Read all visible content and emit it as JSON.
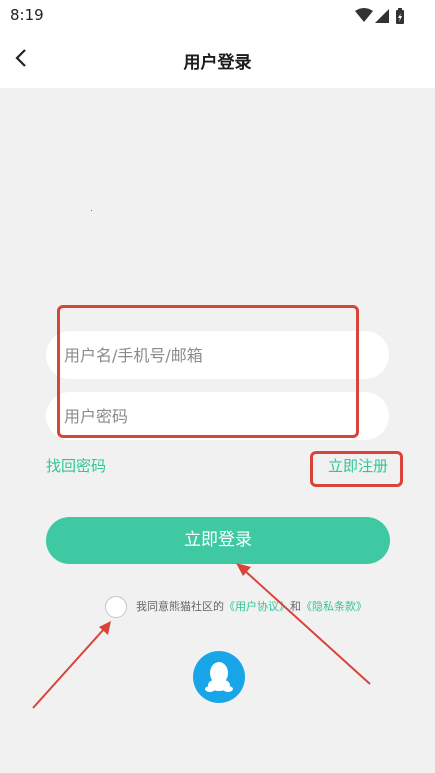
{
  "status_bar": {
    "time": "8:19",
    "icons": [
      "wifi-icon",
      "signal-icon",
      "battery-icon"
    ]
  },
  "header": {
    "back_icon": "chevron-left-icon",
    "title": "用户登录"
  },
  "form": {
    "username_placeholder": "用户名/手机号/邮箱",
    "password_placeholder": "用户密码",
    "forgot_label": "找回密码",
    "register_label": "立即注册",
    "login_label": "立即登录"
  },
  "agreement": {
    "prefix": "我同意熊猫社区的",
    "user_agreement": "《用户协议》",
    "conjunction": "和",
    "privacy_policy": "《隐私条款》",
    "checked": false
  },
  "third_party": {
    "qq_icon": "qq-penguin-icon"
  },
  "colors": {
    "accent": "#3ec9a3",
    "link": "#2fc69a",
    "annotation_red": "#d9443a",
    "qq_blue": "#18a6e9",
    "background": "#f1f1f1"
  }
}
